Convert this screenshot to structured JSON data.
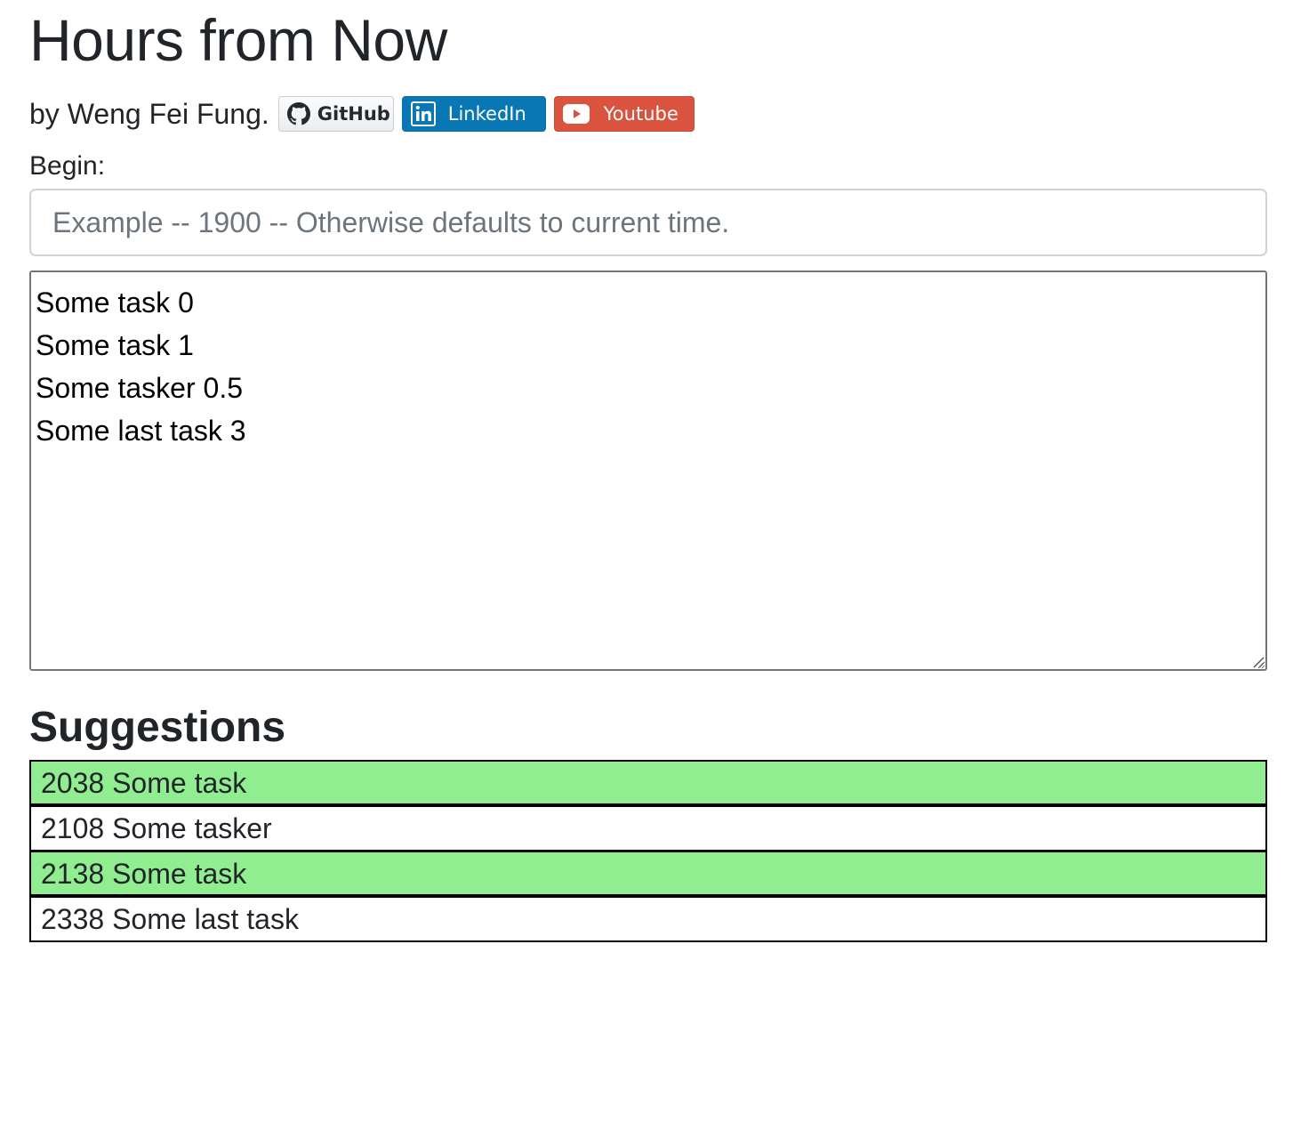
{
  "header": {
    "title": "Hours from Now",
    "byline": "by Weng Fei Fung.",
    "links": {
      "github": "GitHub",
      "linkedin": "LinkedIn",
      "youtube": "Youtube"
    }
  },
  "begin": {
    "label": "Begin:",
    "value": "",
    "placeholder": "Example -- 1900 -- Otherwise defaults to current time."
  },
  "tasks": {
    "value": "Some task 0\nSome task 1\nSome tasker 0.5\nSome last task 3"
  },
  "suggestions": {
    "heading": "Suggestions",
    "items": [
      {
        "text": "2038 Some task",
        "highlight_color": "#90ee90"
      },
      {
        "text": "2108 Some tasker",
        "highlight_color": "#ffffff"
      },
      {
        "text": "2138 Some task",
        "highlight_color": "#90ee90"
      },
      {
        "text": "2338 Some last task",
        "highlight_color": "#ffffff"
      }
    ]
  },
  "colors": {
    "linkedin": "#0a77b5",
    "youtube": "#d9533f",
    "highlight": "#90ee90"
  }
}
